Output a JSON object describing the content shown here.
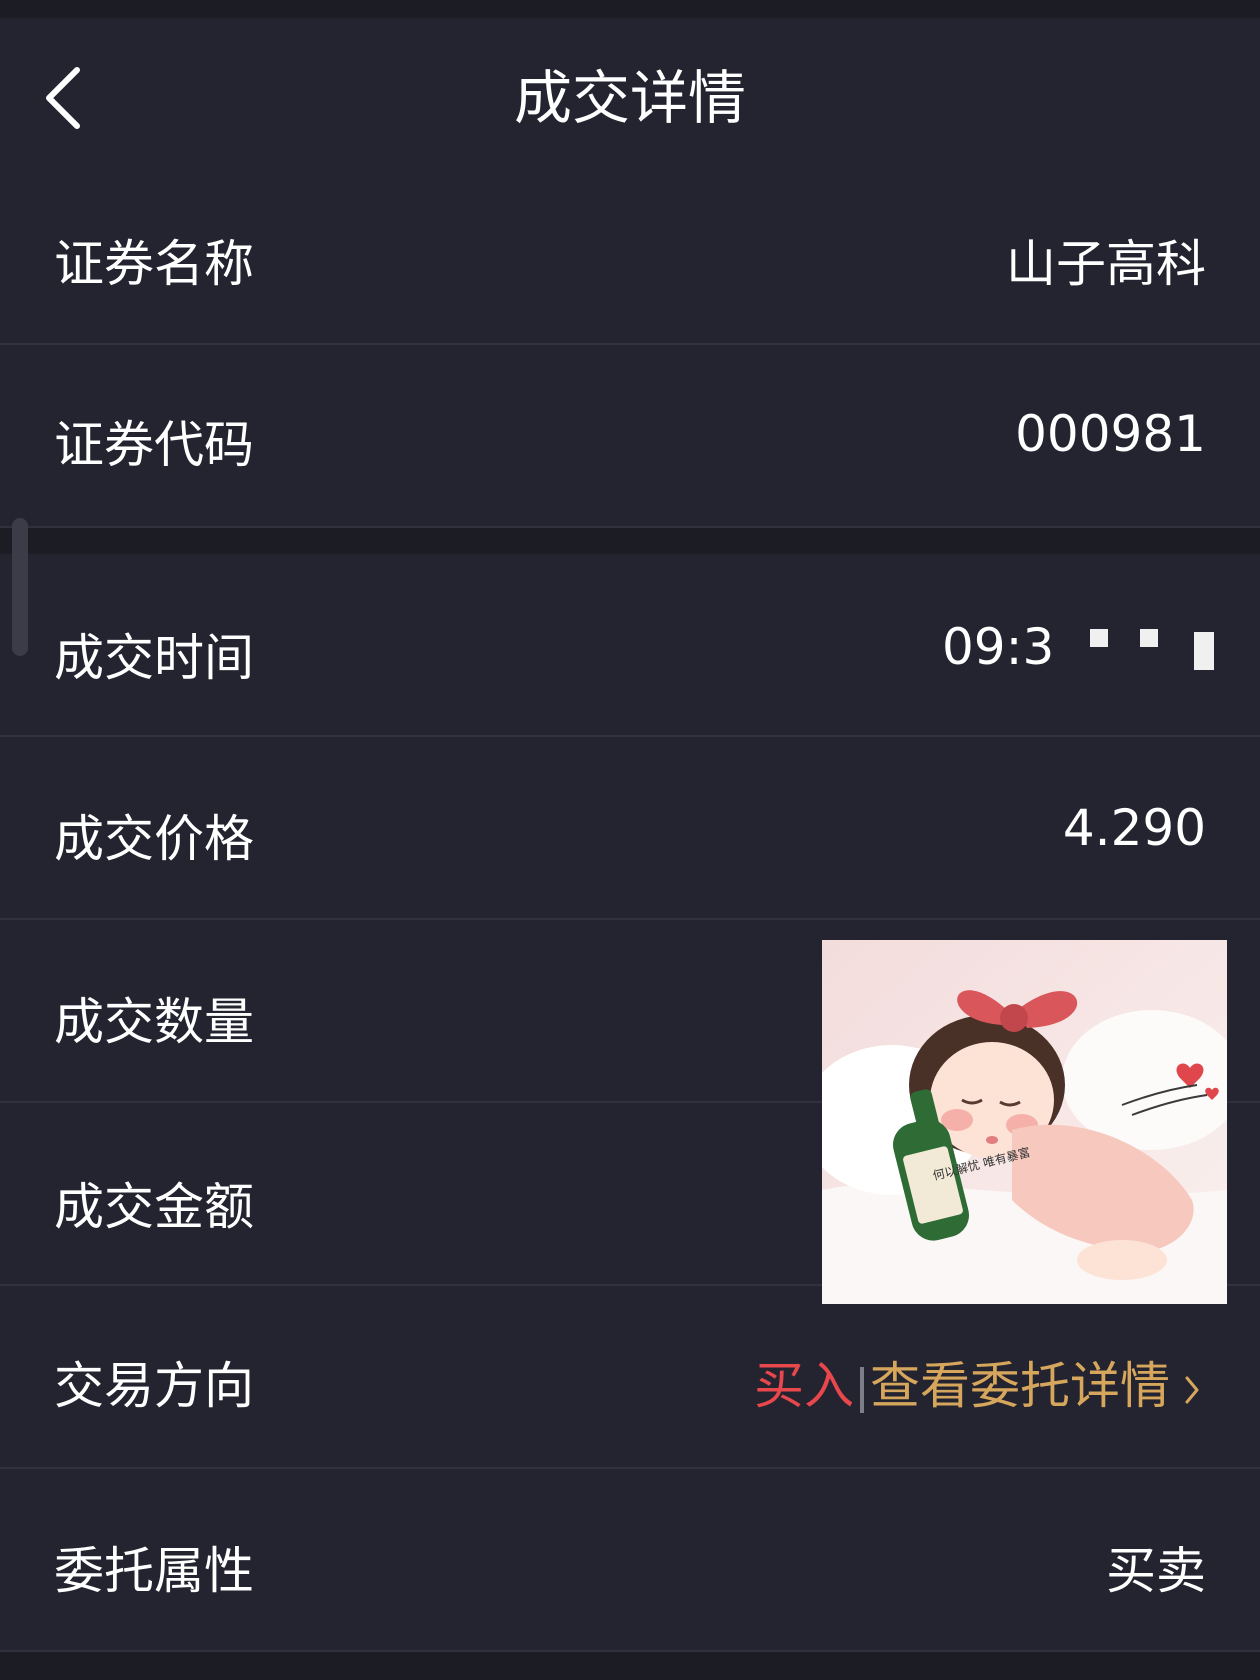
{
  "header": {
    "title": "成交详情",
    "back_icon": "chevron-left-icon"
  },
  "rows": [
    {
      "label": "证券名称",
      "value": "山子高科"
    },
    {
      "label": "证券代码",
      "value": "000981"
    },
    {
      "label": "成交时间",
      "value": "09:3"
    },
    {
      "label": "成交价格",
      "value": "4.290"
    },
    {
      "label": "成交数量",
      "value": ""
    },
    {
      "label": "成交金额",
      "value": ""
    },
    {
      "label": "交易方向",
      "value_buy": "买入",
      "link_text": "查看委托详情"
    },
    {
      "label": "委托属性",
      "value": "买卖"
    }
  ],
  "overlay_image": {
    "bottle_text": "何以解忧 唯有暴富"
  },
  "colors": {
    "background": "#232430",
    "buy": "#e8474c",
    "link": "#d6a65c"
  }
}
